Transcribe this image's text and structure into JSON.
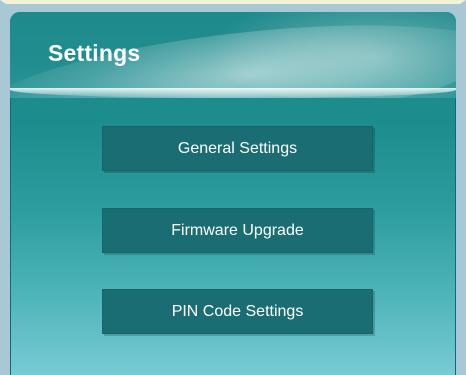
{
  "header": {
    "title": "Settings"
  },
  "menu": {
    "items": [
      {
        "label": "General Settings"
      },
      {
        "label": "Firmware Upgrade"
      },
      {
        "label": "PIN Code Settings"
      }
    ]
  },
  "colors": {
    "panel_top": "#1e8989",
    "panel_bottom": "#79cbd4",
    "button_bg": "#196d73",
    "text": "#ffffff"
  }
}
